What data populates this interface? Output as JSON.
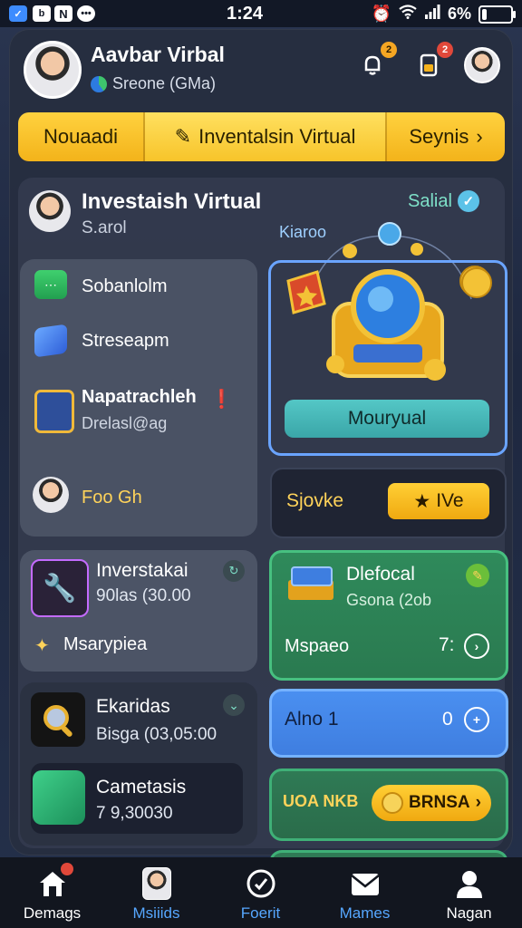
{
  "status_bar": {
    "time": "1:24",
    "battery": "6%",
    "battery_level": 0.2,
    "left_icon_letter": "b"
  },
  "header": {
    "name": "Aavbar Virbal",
    "subtitle": "Sreone (GMa)",
    "notif_badge": "2",
    "wallet_badge": "2"
  },
  "nav": {
    "left": "Nouaadi",
    "active": "Inventalsin Virtual",
    "right": "Seynis"
  },
  "investment": {
    "title": "Investaish Virtual",
    "subtitle": "S.arol",
    "status": "Salial",
    "hero_caption": "Kiaroo",
    "hero_button": "Mouryual"
  },
  "list_items": [
    {
      "label": "Sobanlolm",
      "icon": "chat-icon"
    },
    {
      "label": "Streseapm",
      "icon": "stack-icon"
    },
    {
      "label": "Napatrachleh",
      "sub": "Drelasl@ag",
      "icon": "notebook-icon"
    },
    {
      "label": "Foo Gh",
      "icon": "avatar-icon"
    }
  ],
  "skill_card": {
    "label": "Sjovke",
    "button": "IVe"
  },
  "tool_card": {
    "title": "Inverstakai",
    "value": "90las (30.00",
    "footer": "Msarypiea"
  },
  "green_card": {
    "title": "Dlefocal",
    "value": "Gsona (2ob",
    "footer": "Mspaeo",
    "count": "7:"
  },
  "analytics_card": {
    "title": "Ekaridas",
    "value": "Bisga (03,05:00"
  },
  "inner_card": {
    "title": "Cametasis",
    "value": "7 9,30030"
  },
  "blue_card": {
    "label": "Alno 1",
    "count": "0"
  },
  "green_card2": {
    "label": "UOA NKB",
    "button": "BRNSA"
  },
  "tabs": [
    {
      "label": "Demags",
      "icon": "home-icon",
      "color": "#ffffff"
    },
    {
      "label": "Msiiids",
      "icon": "profile-icon",
      "color": "#56a7ff"
    },
    {
      "label": "Foerit",
      "icon": "compass-icon",
      "color": "#56a7ff"
    },
    {
      "label": "Mames",
      "icon": "mail-icon",
      "color": "#56a7ff"
    },
    {
      "label": "Nagan",
      "icon": "user-icon",
      "color": "#ffffff"
    }
  ],
  "colors": {
    "accent_yellow": "#f7c42a",
    "accent_blue": "#4a8ff0",
    "accent_green": "#2f8a5b",
    "teal": "#54c7c6"
  }
}
